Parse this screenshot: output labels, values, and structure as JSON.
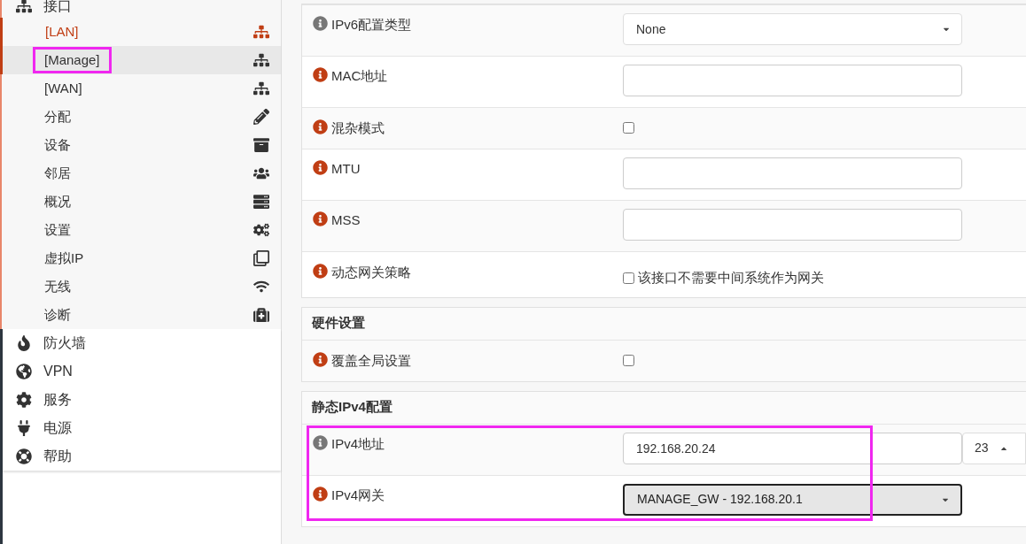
{
  "sidebar": {
    "group": {
      "label": "接口",
      "children": [
        {
          "label": "[LAN]",
          "selected": true,
          "hovered": false
        },
        {
          "label": "[Manage]",
          "selected": false,
          "hovered": true,
          "highlighted": true
        },
        {
          "label": "[WAN]",
          "selected": false,
          "hovered": false
        },
        {
          "label": "分配",
          "selected": false,
          "hovered": false
        },
        {
          "label": "设备",
          "selected": false,
          "hovered": false
        },
        {
          "label": "邻居",
          "selected": false,
          "hovered": false
        },
        {
          "label": "概况",
          "selected": false,
          "hovered": false
        },
        {
          "label": "设置",
          "selected": false,
          "hovered": false
        },
        {
          "label": "虚拟IP",
          "selected": false,
          "hovered": false
        },
        {
          "label": "无线",
          "selected": false,
          "hovered": false
        },
        {
          "label": "诊断",
          "selected": false,
          "hovered": false
        }
      ]
    },
    "items": [
      {
        "label": "防火墙"
      },
      {
        "label": "VPN"
      },
      {
        "label": "服务"
      },
      {
        "label": "电源"
      },
      {
        "label": "帮助"
      }
    ]
  },
  "sections": [
    {
      "highlighted": false,
      "rows": [
        {
          "label": "IPv6配置类型",
          "color": "#777777",
          "kind": "select",
          "value": "None"
        },
        {
          "label": "MAC地址",
          "color": "#c03e14",
          "kind": "text",
          "value": ""
        },
        {
          "label": "混杂模式",
          "color": "#c03e14",
          "kind": "checkbox",
          "checked": false
        },
        {
          "label": "MTU",
          "color": "#c03e14",
          "kind": "text",
          "value": ""
        },
        {
          "label": "MSS",
          "color": "#c03e14",
          "kind": "text",
          "value": ""
        },
        {
          "label": "动态网关策略",
          "color": "#c03e14",
          "kind": "checkbox_label",
          "checked": false,
          "text": "该接口不需要中间系统作为网关"
        }
      ]
    },
    {
      "title": "硬件设置",
      "highlighted": false,
      "rows": [
        {
          "label": "覆盖全局设置",
          "color": "#c03e14",
          "kind": "checkbox",
          "checked": false
        }
      ]
    },
    {
      "title": "静态IPv4配置",
      "highlighted": true,
      "rows": [
        {
          "label": "IPv4地址",
          "color": "#777777",
          "kind": "ip_subnet",
          "value": "192.168.20.24",
          "subnet": "23"
        },
        {
          "label": "IPv4网关",
          "color": "#c03e14",
          "kind": "select_focused",
          "value": "MANAGE_GW - 192.168.20.1"
        }
      ]
    }
  ]
}
